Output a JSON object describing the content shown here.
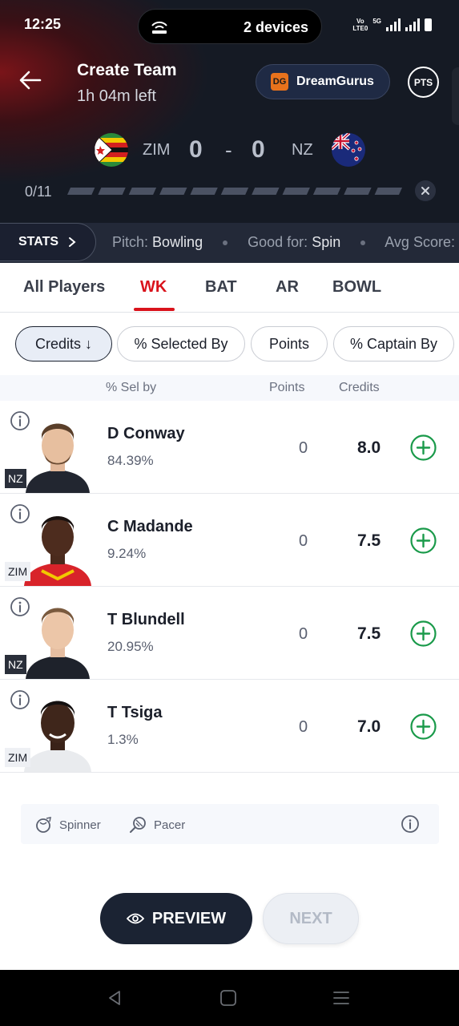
{
  "status_bar": {
    "time": "12:25",
    "devices": "2 devices",
    "network": "Vo LTE0",
    "gen": "5G"
  },
  "header": {
    "title": "Create Team",
    "time_left": "1h 04m left",
    "dg_label": "DreamGurus",
    "dg_logo": "DG",
    "pts_label": "PTS"
  },
  "match": {
    "team1": "ZIM",
    "score1": "0",
    "separator": "-",
    "score2": "0",
    "team2": "NZ",
    "selected_count": "0/11",
    "progress_segments": 11
  },
  "stats": {
    "button": "STATS",
    "pitch_label": "Pitch:",
    "pitch_value": "Bowling",
    "good_label": "Good for:",
    "good_value": "Spin",
    "avg_label": "Avg Score:"
  },
  "tabs": [
    "All Players",
    "WK",
    "BAT",
    "AR",
    "BOWL"
  ],
  "active_tab": "WK",
  "sort_chips": {
    "credits": "Credits ↓",
    "selected_by": "% Selected By",
    "points": "Points",
    "captain_by": "% Captain By"
  },
  "columns": {
    "sel_by": "% Sel by",
    "points": "Points",
    "credits": "Credits"
  },
  "players": [
    {
      "name": "D Conway",
      "sel": "84.39%",
      "points": "0",
      "credits": "8.0",
      "team": "NZ"
    },
    {
      "name": "C Madande",
      "sel": "9.24%",
      "points": "0",
      "credits": "7.5",
      "team": "ZIM"
    },
    {
      "name": "T Blundell",
      "sel": "20.95%",
      "points": "0",
      "credits": "7.5",
      "team": "NZ"
    },
    {
      "name": "T Tsiga",
      "sel": "1.3%",
      "points": "0",
      "credits": "7.0",
      "team": "ZIM"
    }
  ],
  "legend": {
    "spinner": "Spinner",
    "pacer": "Pacer"
  },
  "buttons": {
    "preview": "PREVIEW",
    "next": "NEXT"
  },
  "colors": {
    "accent": "#d9131c",
    "add": "#1a9a4a",
    "dark": "#151a24"
  }
}
